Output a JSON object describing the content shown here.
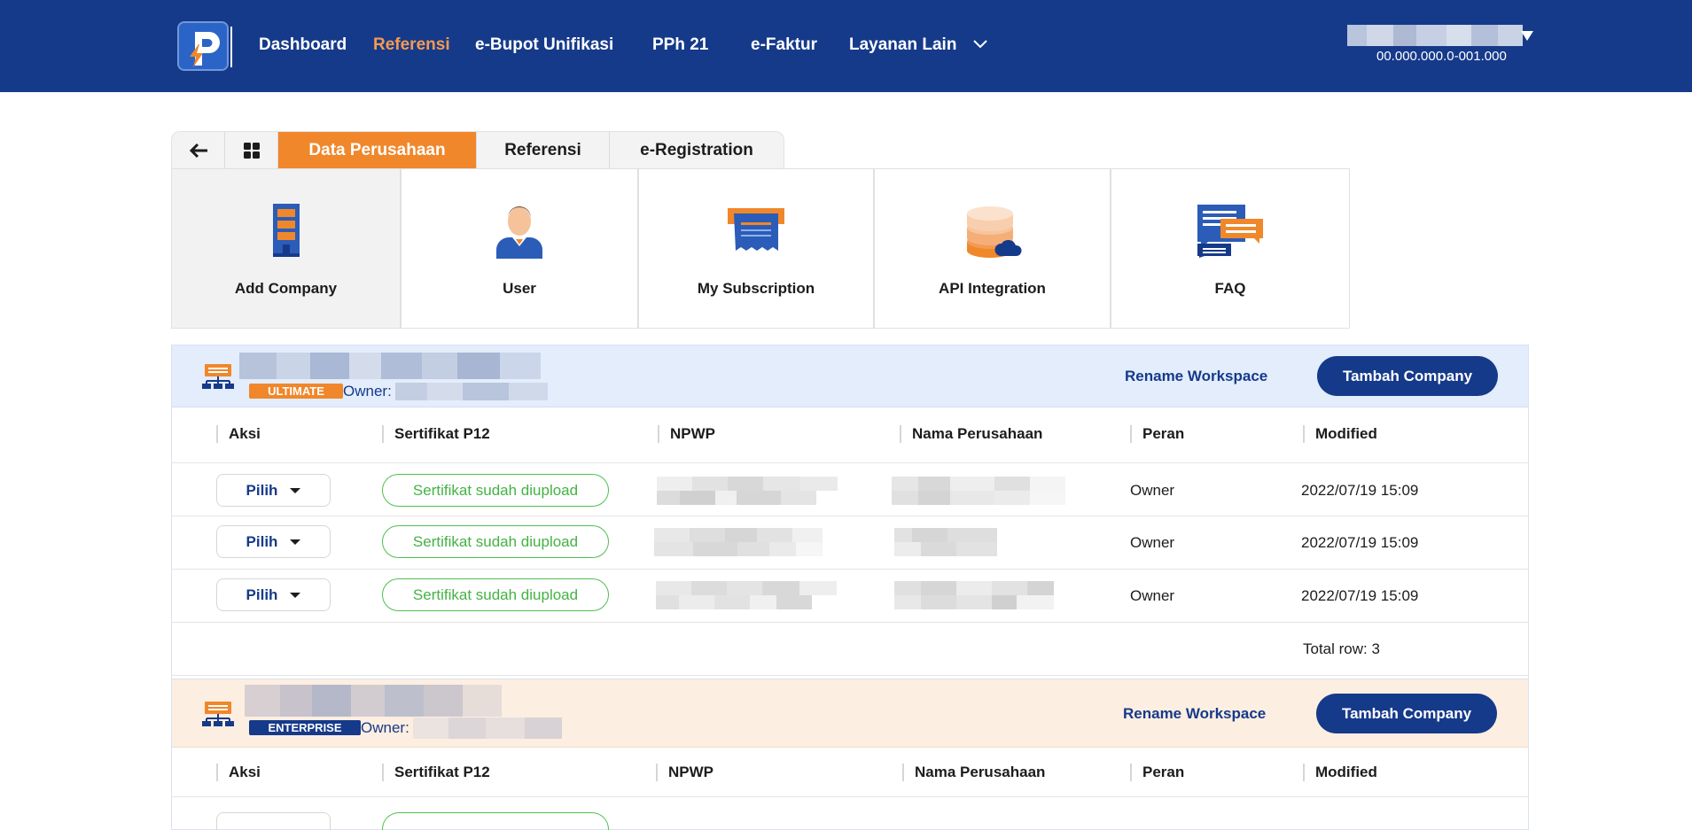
{
  "nav": {
    "items": [
      "Dashboard",
      "Referensi",
      "e-Bupot Unifikasi",
      "PPh 21",
      "e-Faktur",
      "Layanan Lain"
    ],
    "active": "Referensi",
    "user_id": "00.000.000.0-001.000"
  },
  "tabs": {
    "back_icon": "arrow-left-icon",
    "grid_icon": "grid-icon",
    "items": [
      "Data Perusahaan",
      "Referensi",
      "e-Registration"
    ],
    "active": "Data Perusahaan"
  },
  "cards": [
    {
      "label": "Add Company",
      "icon": "building-icon"
    },
    {
      "label": "User",
      "icon": "user-icon"
    },
    {
      "label": "My Subscription",
      "icon": "receipt-icon"
    },
    {
      "label": "API Integration",
      "icon": "database-cloud-icon"
    },
    {
      "label": "FAQ",
      "icon": "chat-bubbles-icon"
    }
  ],
  "workspaces": [
    {
      "plan": "ULTIMATE",
      "owner_label": "Owner:",
      "rename_label": "Rename Workspace",
      "add_label": "Tambah Company",
      "columns": [
        "Aksi",
        "Sertifikat P12",
        "NPWP",
        "Nama Perusahaan",
        "Peran",
        "Modified"
      ],
      "rows": [
        {
          "action": "Pilih",
          "cert": "Sertifikat sudah diupload",
          "role": "Owner",
          "modified": "2022/07/19 15:09"
        },
        {
          "action": "Pilih",
          "cert": "Sertifikat sudah diupload",
          "role": "Owner",
          "modified": "2022/07/19 15:09"
        },
        {
          "action": "Pilih",
          "cert": "Sertifikat sudah diupload",
          "role": "Owner",
          "modified": "2022/07/19 15:09"
        }
      ],
      "total": "Total row: 3"
    },
    {
      "plan": "ENTERPRISE",
      "owner_label": "Owner:",
      "rename_label": "Rename Workspace",
      "add_label": "Tambah Company",
      "columns": [
        "Aksi",
        "Sertifikat P12",
        "NPWP",
        "Nama Perusahaan",
        "Peran",
        "Modified"
      ]
    }
  ],
  "colors": {
    "brand_navy": "#163a8a",
    "accent_orange": "#f0872b",
    "ultimate_bg": "#e3edfb",
    "enterprise_bg": "#fdeee2",
    "cert_green": "#44b244"
  }
}
